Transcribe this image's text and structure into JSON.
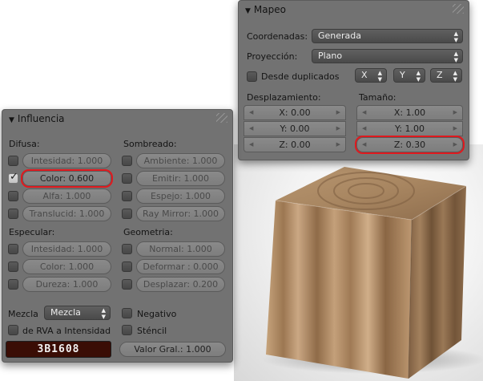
{
  "mapeo": {
    "title": "Mapeo",
    "coordenadas_label": "Coordenadas:",
    "coordenadas_value": "Generada",
    "proyeccion_label": "Proyección:",
    "proyeccion_value": "Plano",
    "desde_duplicados_label": "Desde duplicados",
    "axis_x": "X",
    "axis_y": "Y",
    "axis_z": "Z",
    "desplazamiento_label": "Desplazamiento:",
    "desplazamiento": [
      "X: 0.00",
      "Y: 0.00",
      "Z: 0.00"
    ],
    "tamano_label": "Tamaño:",
    "tamano": [
      "X: 1.00",
      "Y: 1.00",
      "Z: 0.30"
    ]
  },
  "influencia": {
    "title": "Influencia",
    "difusa_label": "Difusa:",
    "intensidad": "Intesidad: 1.000",
    "color": "Color: 0.600",
    "alfa": "Alfa: 1.000",
    "translucid": "Translucid: 1.000",
    "sombreado_label": "Sombreado:",
    "ambiente": "Ambiente: 1.000",
    "emitir": "Emitir: 1.000",
    "espejo": "Espejo: 1.000",
    "ray_mirror": "Ray Mirror: 1.000",
    "especular_label": "Especular:",
    "esp_intensidad": "Intesidad: 1.000",
    "esp_color": "Color: 1.000",
    "dureza": "Dureza: 1.000",
    "geometria_label": "Geometria:",
    "normal": "Normal: 1.000",
    "deformar": "Deformar : 0.000",
    "desplazar": "Desplazar: 0.200",
    "mezcla_label": "Mezcla",
    "mezcla_value": "Mezcla",
    "negativo_label": "Negativo",
    "rva_label": "de RVA a Intensidad",
    "stencil_label": "Sténcil",
    "hex_color": "3B1608",
    "valor_gral": "Valor Gral.: 1.000"
  },
  "colors": {
    "panel_bg": "#727272",
    "highlight": "#e0191e",
    "hex_swatch": "#3b1608",
    "wood_light": "#c9a57d",
    "wood_dark": "#7a5b3e"
  }
}
